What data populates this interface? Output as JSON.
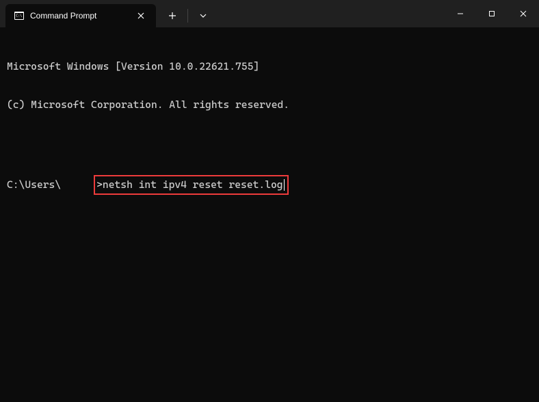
{
  "tab": {
    "title": "Command Prompt"
  },
  "terminal": {
    "line1": "Microsoft Windows [Version 10.0.22621.755]",
    "line2": "(c) Microsoft Corporation. All rights reserved.",
    "prompt_prefix": "C:\\Users\\",
    "prompt_suffix": ">",
    "command": "netsh int ipv4 reset reset.log"
  }
}
